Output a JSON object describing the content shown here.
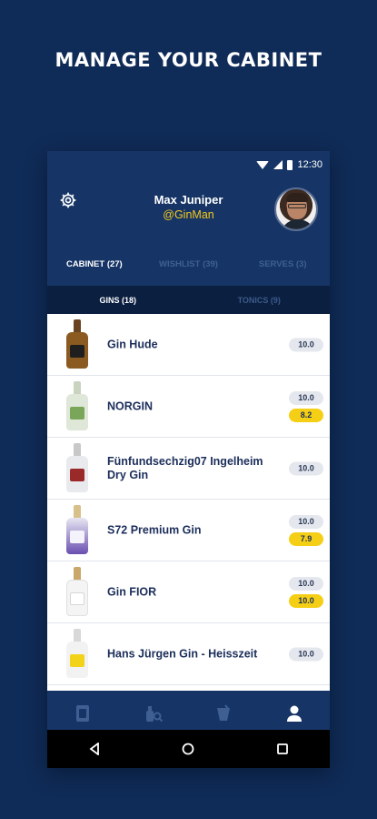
{
  "headline": "MANAGE YOUR CABINET",
  "status_bar": {
    "time": "12:30"
  },
  "profile": {
    "name": "Max Juniper",
    "handle": "@GinMan"
  },
  "main_tabs": [
    {
      "label": "CABINET (27)",
      "active": true
    },
    {
      "label": "WISHLIST (39)",
      "active": false
    },
    {
      "label": "SERVES (3)",
      "active": false
    }
  ],
  "sub_tabs": [
    {
      "label": "GINS (18)",
      "active": true
    },
    {
      "label": "TONICS (9)",
      "active": false
    }
  ],
  "items": [
    {
      "name": "Gin Hude",
      "rating": "10.0",
      "community_rating": "",
      "bottle": "amber"
    },
    {
      "name": "NORGIN",
      "rating": "10.0",
      "community_rating": "8.2",
      "bottle": "green"
    },
    {
      "name": "Fünfundsechzig07 Ingelheim Dry Gin",
      "rating": "10.0",
      "community_rating": "",
      "bottle": "clear"
    },
    {
      "name": "S72 Premium Gin",
      "rating": "10.0",
      "community_rating": "7.9",
      "bottle": "purple"
    },
    {
      "name": "Gin FIOR",
      "rating": "10.0",
      "community_rating": "10.0",
      "bottle": "white"
    },
    {
      "name": "Hans Jürgen Gin - Heisszeit",
      "rating": "10.0",
      "community_rating": "",
      "bottle": "yellow"
    }
  ],
  "bottom_nav": [
    {
      "icon": "cabinet-icon",
      "active": false
    },
    {
      "icon": "search-bottle-icon",
      "active": false
    },
    {
      "icon": "cocktail-icon",
      "active": false
    },
    {
      "icon": "profile-icon",
      "active": true
    }
  ],
  "colors": {
    "background": "#0f2b57",
    "app": "#163566",
    "accent_yellow": "#f5cf16",
    "handle_yellow": "#f4c81c",
    "text_dark": "#1b2e5a",
    "inactive_tab": "#3f5f93"
  }
}
